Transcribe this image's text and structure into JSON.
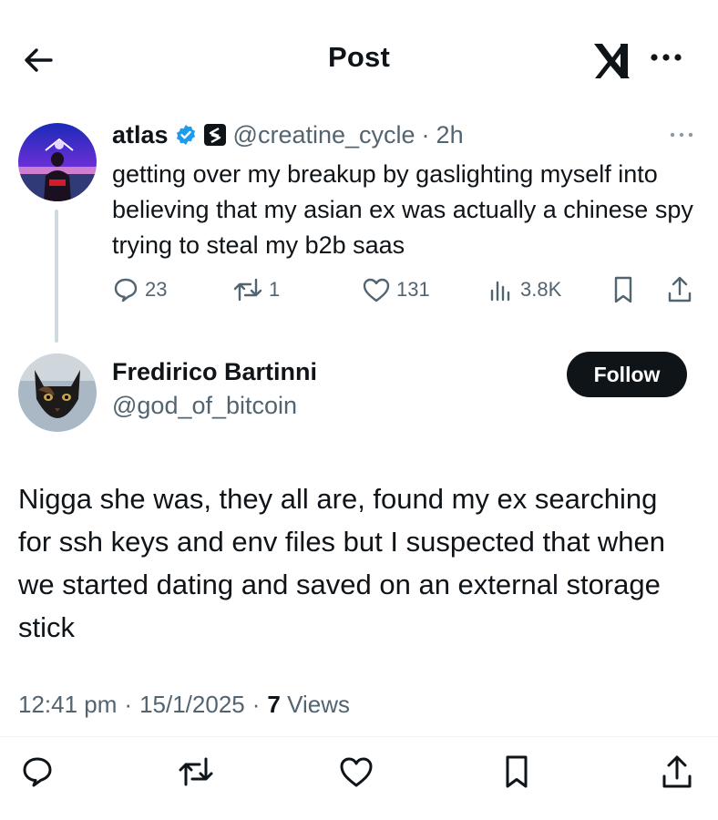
{
  "header": {
    "title": "Post",
    "back_icon": "arrow-left-icon",
    "logo_icon": "x-logo-icon",
    "more_icon": "more-icon"
  },
  "parent_post": {
    "display_name": "atlas",
    "verified_icon": "verified-badge-icon",
    "affiliate_icon": "affiliate-badge-icon",
    "handle": "@creatine_cycle",
    "separator": "·",
    "time": "2h",
    "text": "getting over my breakup by gaslighting myself into believing that my asian ex was actually a chinese spy trying to steal my b2b saas",
    "replies": "23",
    "reposts": "1",
    "likes": "131",
    "views": "3.8K"
  },
  "reply_post": {
    "display_name": "Fredirico Bartinni",
    "handle": "@god_of_bitcoin",
    "follow_label": "Follow",
    "text": "Nigga she was, they all are, found my ex searching for ssh keys and env files but I suspected that when we started dating and saved on an external storage stick",
    "time": "12:41 pm",
    "separator": "·",
    "date": "15/1/2025",
    "views_count": "7",
    "views_label": "Views"
  },
  "colors": {
    "text": "#0f1419",
    "secondary": "#536471",
    "verified": "#1d9bf0",
    "button": "#0f1419"
  }
}
